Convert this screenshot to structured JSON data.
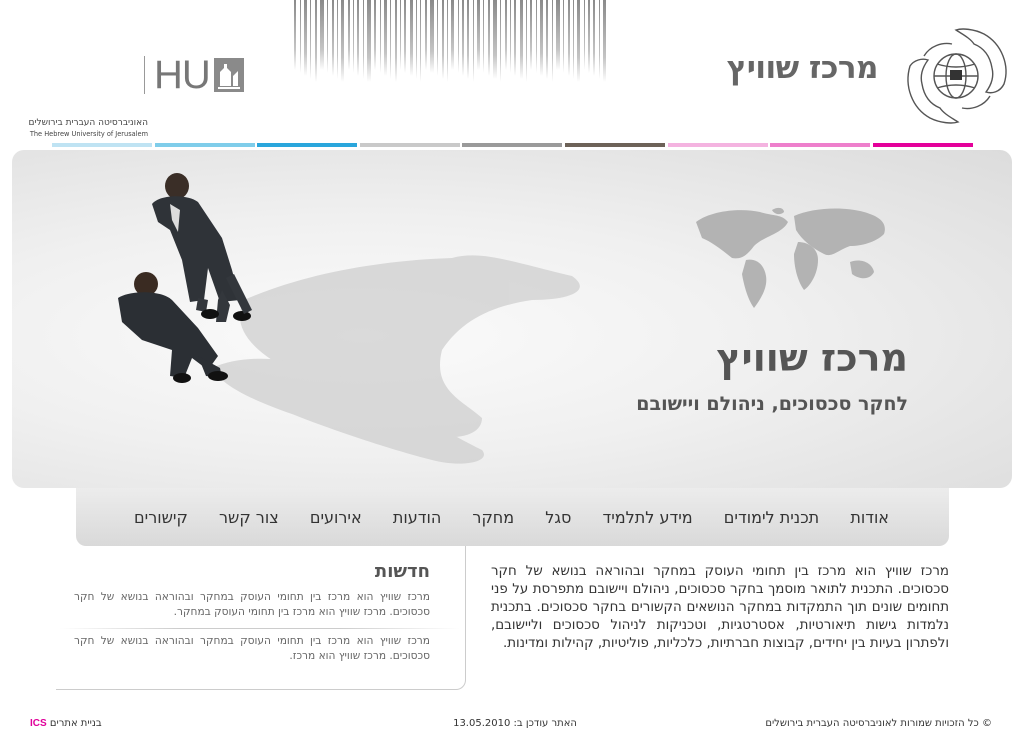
{
  "header": {
    "university_name_he": "האוניברסיטה העברית בירושלים",
    "university_name_en": "The Hebrew University of Jerusalem",
    "university_mark": "HU",
    "site_title": "מרכז שוויץ"
  },
  "color_rules": [
    "#bfe3f3",
    "#7fcdea",
    "#2aa6dc",
    "#c9c9c9",
    "#9a9a9a",
    "#6d6258",
    "#f4b3e0",
    "#ee7fcc",
    "#e4009a"
  ],
  "hero": {
    "title": "מרכז שוויץ",
    "subtitle": "לחקר סכסוכים, ניהולם ויישובם"
  },
  "nav": {
    "items": [
      "אודות",
      "תכנית לימודים",
      "מידע לתלמיד",
      "סגל",
      "מחקר",
      "הודעות",
      "אירועים",
      "צור קשר",
      "קישורים"
    ]
  },
  "main": {
    "text": "מרכז שוויץ הוא מרכז בין תחומי העוסק במחקר ובהוראה בנושא של חקר סכסוכים. התכנית לתואר מוסמך בחקר סכסוכים, ניהולם ויישובם מתפרסת על פני תחומים שונים תוך התמקדות במחקר הנושאים הקשורים בחקר סכסוכים.   בתכנית נלמדות גישות תיאורטיות, אסטרטגיות, וטכניקות לניהול סכסוכים וליישובם, ולפתרון בעיות בין יחידים, קבוצות חברתיות, כלכליות, פוליטיות, קהילות ומדינות."
  },
  "news": {
    "title": "חדשות",
    "items": [
      "מרכז שוויץ הוא מרכז בין תחומי העוסק במחקר ובהוראה בנושא של חקר סכסוכים. מרכז שוויץ הוא מרכז בין תחומי העוסק במחקר.",
      "מרכז שוויץ הוא מרכז בין תחומי העוסק במחקר ובהוראה בנושא של חקר סכסוכים. מרכז שוויץ הוא מרכז."
    ]
  },
  "footer": {
    "copyright": "© כל הזכויות שמורות לאוניברסיטה העברית בירושלים",
    "updated": "האתר עודכן ב: 13.05.2010",
    "credit": "בניית אתרים",
    "credit_brand": "ICS"
  }
}
